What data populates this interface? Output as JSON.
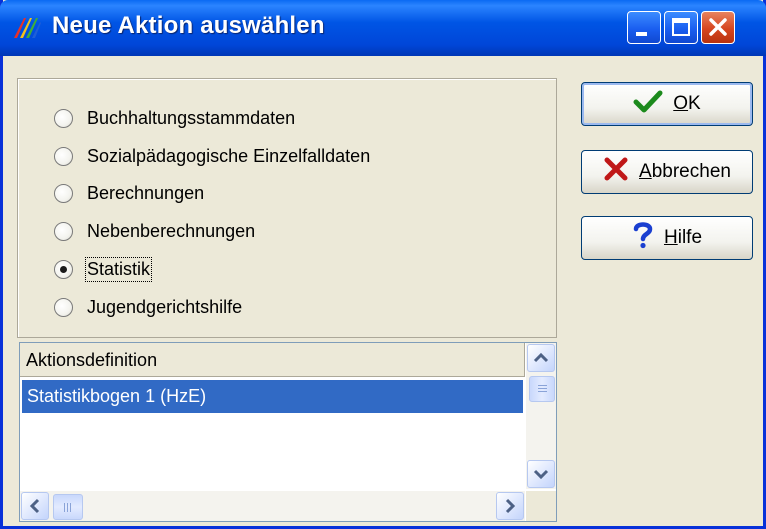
{
  "window": {
    "title": "Neue Aktion auswählen"
  },
  "actions": {
    "ok": {
      "mnemonic": "O",
      "rest": "K"
    },
    "cancel": {
      "mnemonic": "A",
      "rest": "bbrechen"
    },
    "help": {
      "mnemonic": "H",
      "rest": "ilfe"
    }
  },
  "radio_options": [
    {
      "label": "Buchhaltungsstammdaten",
      "selected": false
    },
    {
      "label": "Sozialpädagogische Einzelfalldaten",
      "selected": false
    },
    {
      "label": "Berechnungen",
      "selected": false
    },
    {
      "label": "Nebenberechnungen",
      "selected": false
    },
    {
      "label": "Statistik",
      "selected": true
    },
    {
      "label": "Jugendgerichtshilfe",
      "selected": false
    }
  ],
  "list": {
    "column_header": "Aktionsdefinition",
    "rows": [
      "Statistikbogen 1 (HzE)"
    ],
    "selected_index": 0
  },
  "icons": {
    "ok": "checkmark-icon",
    "cancel": "red-x-icon",
    "help": "question-mark-icon",
    "app": "app-logo-icon"
  },
  "colors": {
    "titlebar": "#0055e5",
    "selection": "#316ac5",
    "ok_check": "#1c8a1c",
    "cancel_x": "#c01818",
    "help_q": "#1a3fd0"
  }
}
